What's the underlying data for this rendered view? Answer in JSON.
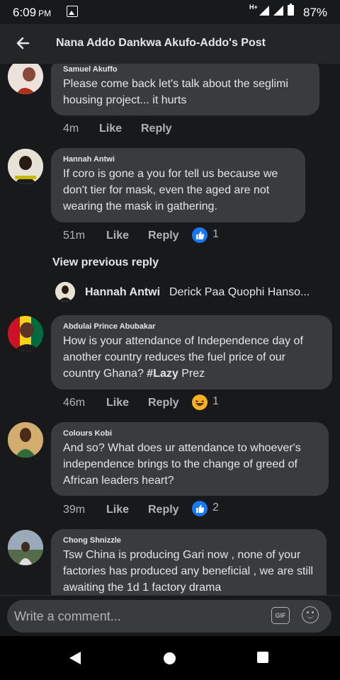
{
  "status_bar": {
    "time": "6:09",
    "ampm": "PM",
    "network": "H+",
    "battery": "87%"
  },
  "header": {
    "title": "Nana Addo Dankwa Akufo-Addo's Post"
  },
  "comments": [
    {
      "author": "Samuel Akuffo",
      "text": "Please come back let's talk about the seglimi housing project... it hurts",
      "time": "4m",
      "like": "Like",
      "reply": "Reply"
    },
    {
      "author": "Hannah Antwi",
      "text": "If coro is gone a you for tell us because we don't tier for mask, even the aged are not wearing the mask in gathering.",
      "time": "51m",
      "like": "Like",
      "reply": "Reply",
      "reaction_icon": "like-reaction-icon",
      "reaction_count": "1"
    },
    {
      "author": "Abdulai Prince Abubakar",
      "text": "How is your attendance of Independence day of another country reduces the fuel price of our country Ghana? ",
      "hashtag": "#Lazy",
      "text_after": " Prez",
      "time": "46m",
      "like": "Like",
      "reply": "Reply",
      "reaction_icon": "haha-reaction-icon",
      "reaction_count": "1"
    },
    {
      "author": "Colours Kobi",
      "text": "And so? What does ur attendance to whoever's independence brings to the change of greed of African leaders heart?",
      "time": "39m",
      "like": "Like",
      "reply": "Reply",
      "reaction_icon": "like-reaction-icon",
      "reaction_count": "2"
    },
    {
      "author": "Chong Shnizzle",
      "text": "Tsw China is producing Gari now , none of your factories has produced any beneficial , we are still awaiting the 1d 1 factory drama"
    }
  ],
  "view_previous": "View previous reply",
  "reply_preview": {
    "author": "Hannah Antwi",
    "text": "Derick Paa Quophi Hanso..."
  },
  "composer": {
    "placeholder": "Write a comment...",
    "gif_label": "GIF"
  },
  "colors": {
    "background": "#18191a",
    "bubble": "#3a3b3c",
    "like_blue": "#1877f2"
  }
}
